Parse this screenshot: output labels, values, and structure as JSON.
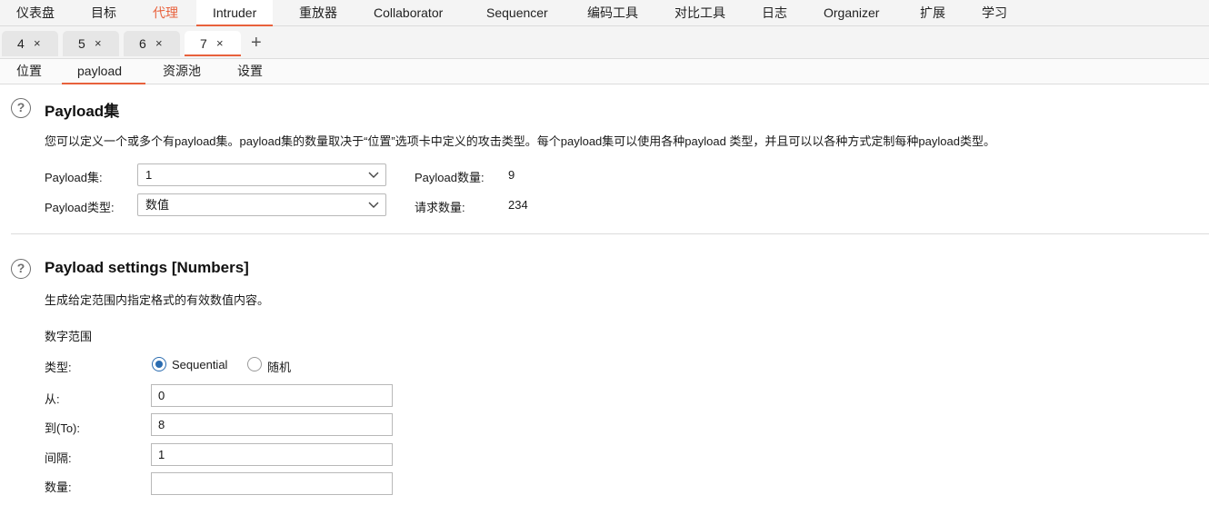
{
  "topnav": {
    "items": [
      "仪表盘",
      "目标",
      "代理",
      "Intruder",
      "重放器",
      "Collaborator",
      "Sequencer",
      "编码工具",
      "对比工具",
      "日志",
      "Organizer",
      "扩展",
      "学习"
    ]
  },
  "tabs": {
    "items": [
      {
        "label": "4",
        "close": "×"
      },
      {
        "label": "5",
        "close": "×"
      },
      {
        "label": "6",
        "close": "×"
      },
      {
        "label": "7",
        "close": "×"
      }
    ],
    "add": "+"
  },
  "subtabs": [
    "位置",
    "payload",
    "资源池",
    "设置"
  ],
  "payload_sets": {
    "title": "Payload集",
    "description": "您可以定义一个或多个有payload集。payload集的数量取决于“位置”选项卡中定义的攻击类型。每个payload集可以使用各种payload 类型，并且可以以各种方式定制每种payload类型。",
    "set_label": "Payload集:",
    "set_value": "1",
    "type_label": "Payload类型:",
    "type_value": "数值",
    "count_label": "Payload数量:",
    "count_value": "9",
    "requests_label": "请求数量:",
    "requests_value": "234"
  },
  "payload_settings": {
    "title": "Payload settings [Numbers]",
    "description": "生成给定范围内指定格式的有效数值内容。",
    "range_heading": "数字范围",
    "type_label": "类型:",
    "option_sequential": "Sequential",
    "option_random": "随机",
    "from_label": "从:",
    "from_value": "0",
    "to_label": "到(To):",
    "to_value": "8",
    "step_label": "间隔:",
    "step_value": "1",
    "count_label": "数量:",
    "count_value": ""
  },
  "colors": {
    "accent": "#e8613c",
    "radio": "#2b6cb0"
  },
  "icons": {
    "help": "question-circle-icon",
    "chevron": "chevron-down-icon",
    "close": "close-icon",
    "add": "plus-icon"
  }
}
